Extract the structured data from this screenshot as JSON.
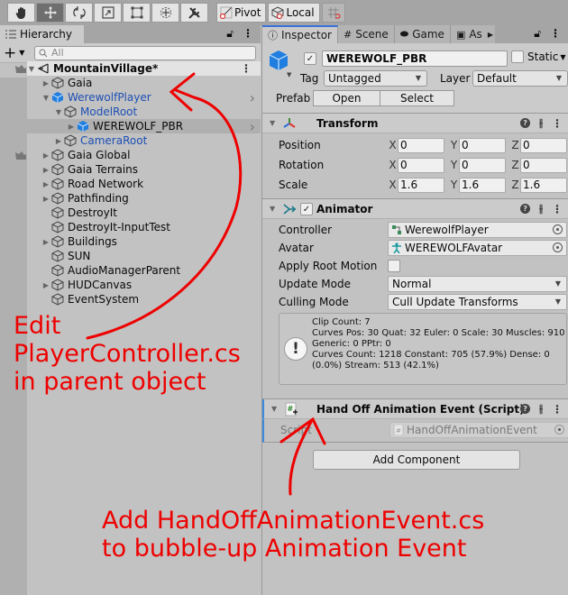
{
  "toolbar": {
    "tools": [
      {
        "name": "hand-tool",
        "icon": "hand-icon"
      },
      {
        "name": "move-tool",
        "icon": "move-icon",
        "active": true
      },
      {
        "name": "rotate-tool",
        "icon": "rotate-icon"
      },
      {
        "name": "scale-tool",
        "icon": "scale-icon"
      },
      {
        "name": "rect-tool",
        "icon": "rect-icon"
      },
      {
        "name": "transform-tool",
        "icon": "transform-icon"
      },
      {
        "name": "custom-tool",
        "icon": "tools-icon"
      }
    ],
    "pivot_label": "Pivot",
    "local_label": "Local"
  },
  "hierarchy": {
    "tab_label": "Hierarchy",
    "search_placeholder": "All",
    "scene_name": "MountainVillage*",
    "items": [
      {
        "label": "Gaia",
        "depth": 1,
        "expandable": true,
        "expanded": false
      },
      {
        "label": "WerewolfPlayer",
        "depth": 1,
        "expandable": true,
        "expanded": true,
        "prefab": true
      },
      {
        "label": "ModelRoot",
        "depth": 2,
        "expandable": true,
        "expanded": true,
        "prefab_child": true
      },
      {
        "label": "WEREWOLF_PBR",
        "depth": 3,
        "expandable": true,
        "expanded": false,
        "prefab": true,
        "selected": true
      },
      {
        "label": "CameraRoot",
        "depth": 2,
        "expandable": true,
        "expanded": false,
        "prefab_child": true
      },
      {
        "label": "Gaia Global",
        "depth": 1,
        "expandable": true,
        "expanded": false
      },
      {
        "label": "Gaia Terrains",
        "depth": 1,
        "expandable": true,
        "expanded": false
      },
      {
        "label": "Road Network",
        "depth": 1,
        "expandable": true,
        "expanded": false
      },
      {
        "label": "Pathfinding",
        "depth": 1,
        "expandable": true,
        "expanded": false
      },
      {
        "label": "DestroyIt",
        "depth": 1,
        "expandable": false
      },
      {
        "label": "DestroyIt-InputTest",
        "depth": 1,
        "expandable": false
      },
      {
        "label": "Buildings",
        "depth": 1,
        "expandable": true,
        "expanded": false
      },
      {
        "label": "SUN",
        "depth": 1,
        "expandable": false
      },
      {
        "label": "AudioManagerParent",
        "depth": 1,
        "expandable": false
      },
      {
        "label": "HUDCanvas",
        "depth": 1,
        "expandable": true,
        "expanded": false
      },
      {
        "label": "EventSystem",
        "depth": 1,
        "expandable": false
      }
    ]
  },
  "inspector": {
    "tabs": [
      {
        "label": "Inspector",
        "icon": "info-icon",
        "active": true
      },
      {
        "label": "Scene",
        "icon": "grid-icon"
      },
      {
        "label": "Game",
        "icon": "gamepad-icon"
      },
      {
        "label": "As",
        "icon": "bag-icon"
      }
    ],
    "object": {
      "active": true,
      "name": "WEREWOLF_PBR",
      "static_label": "Static",
      "tag_label": "Tag",
      "tag_value": "Untagged",
      "layer_label": "Layer",
      "layer_value": "Default",
      "prefab_label": "Prefab",
      "open_label": "Open",
      "select_label": "Select"
    },
    "transform": {
      "title": "Transform",
      "rows": [
        {
          "label": "Position",
          "x": "0",
          "y": "0",
          "z": "0"
        },
        {
          "label": "Rotation",
          "x": "0",
          "y": "0",
          "z": "0"
        },
        {
          "label": "Scale",
          "x": "1.6",
          "y": "1.6",
          "z": "1.6"
        }
      ]
    },
    "animator": {
      "title": "Animator",
      "enabled": true,
      "controller_label": "Controller",
      "controller_value": "WerewolfPlayer",
      "avatar_label": "Avatar",
      "avatar_value": "WEREWOLFAvatar",
      "root_motion_label": "Apply Root Motion",
      "root_motion": false,
      "update_mode_label": "Update Mode",
      "update_mode_value": "Normal",
      "culling_mode_label": "Culling Mode",
      "culling_mode_value": "Cull Update Transforms",
      "info_lines": [
        "Clip Count: 7",
        "Curves Pos: 30 Quat: 32 Euler: 0 Scale: 30 Muscles: 910",
        "Generic: 0 PPtr: 0",
        "Curves Count: 1218 Constant: 705 (57.9%) Dense: 0",
        "(0.0%) Stream: 513 (42.1%)"
      ]
    },
    "script_component": {
      "title": "Hand Off Animation Event (Script)",
      "script_label": "Script",
      "script_value": "HandOffAnimationEvent"
    },
    "add_component_label": "Add Component"
  },
  "annotations": {
    "note1_lines": [
      "Edit",
      "PlayerController.cs",
      "in parent object"
    ],
    "note2_lines": [
      "Add HandOffAnimationEvent.cs",
      "to bubble-up Animation Event"
    ],
    "ink_color": "#ee0000"
  },
  "colors": {
    "prefab_blue": "#1d4fb4",
    "cube_blue": "#1f7ee0",
    "selection": "#b0b0b0",
    "tab_accent": "#3a72d9"
  }
}
